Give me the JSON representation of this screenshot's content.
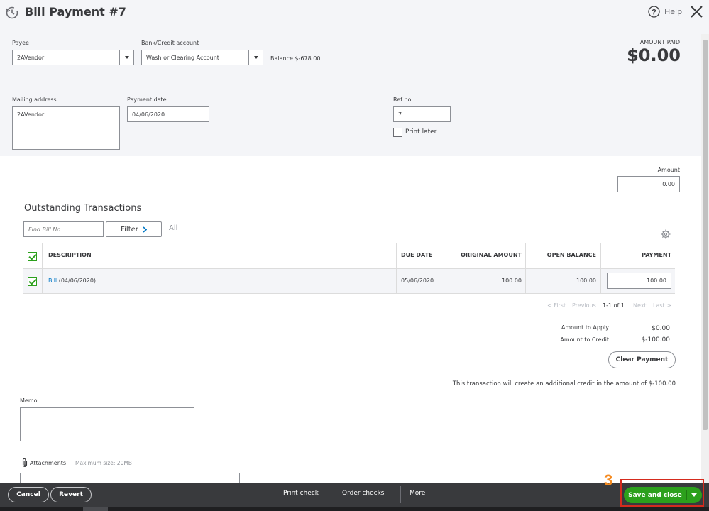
{
  "header": {
    "title": "Bill Payment #7",
    "help_label": "Help",
    "amount_paid_label": "AMOUNT PAID",
    "amount_paid_value": "$0.00"
  },
  "form": {
    "payee_label": "Payee",
    "payee_value": "2AVendor",
    "bank_label": "Bank/Credit account",
    "bank_value": "Wash or Clearing Account",
    "balance_text": "Balance $-678.00",
    "mailing_label": "Mailing address",
    "mailing_value": "2AVendor",
    "payment_date_label": "Payment date",
    "payment_date_value": "04/06/2020",
    "ref_label": "Ref no.",
    "ref_value": "7",
    "print_later_label": "Print later",
    "print_later_checked": false,
    "amount_label": "Amount",
    "amount_value": "0.00"
  },
  "outstanding": {
    "heading": "Outstanding Transactions",
    "find_placeholder": "Find Bill No.",
    "filter_label": "Filter",
    "all_label": "All",
    "columns": [
      "DESCRIPTION",
      "DUE DATE",
      "ORIGINAL AMOUNT",
      "OPEN BALANCE",
      "PAYMENT"
    ],
    "rows": [
      {
        "link": "Bill",
        "desc_rest": " (04/06/2020)",
        "due_date": "05/06/2020",
        "original_amount": "100.00",
        "open_balance": "100.00",
        "payment": "100.00",
        "checked": true
      }
    ],
    "pagination": {
      "first": "< First",
      "previous": "Previous",
      "range": "1-1 of 1",
      "next": "Next",
      "last": "Last >"
    }
  },
  "summary": {
    "apply_label": "Amount to Apply",
    "apply_value": "$0.00",
    "credit_label": "Amount to Credit",
    "credit_value": "$-100.00",
    "clear_payment_label": "Clear Payment",
    "credit_note": "This transaction will create an additional credit in the amount of $-100.00"
  },
  "memo": {
    "memo_label": "Memo",
    "attachments_label": "Attachments",
    "attachments_max": "Maximum size: 20MB"
  },
  "footer": {
    "cancel_label": "Cancel",
    "revert_label": "Revert",
    "print_check_label": "Print check",
    "order_checks_label": "Order checks",
    "more_label": "More",
    "save_close_label": "Save and close",
    "step_number": "3"
  },
  "colors": {
    "accent_green": "#2ca01c",
    "header_bg": "#f4f5f8",
    "footer_bg": "#393a3d",
    "link_blue": "#0077c5",
    "highlight_red": "#d52b1e",
    "step_orange": "#f58a1f"
  }
}
